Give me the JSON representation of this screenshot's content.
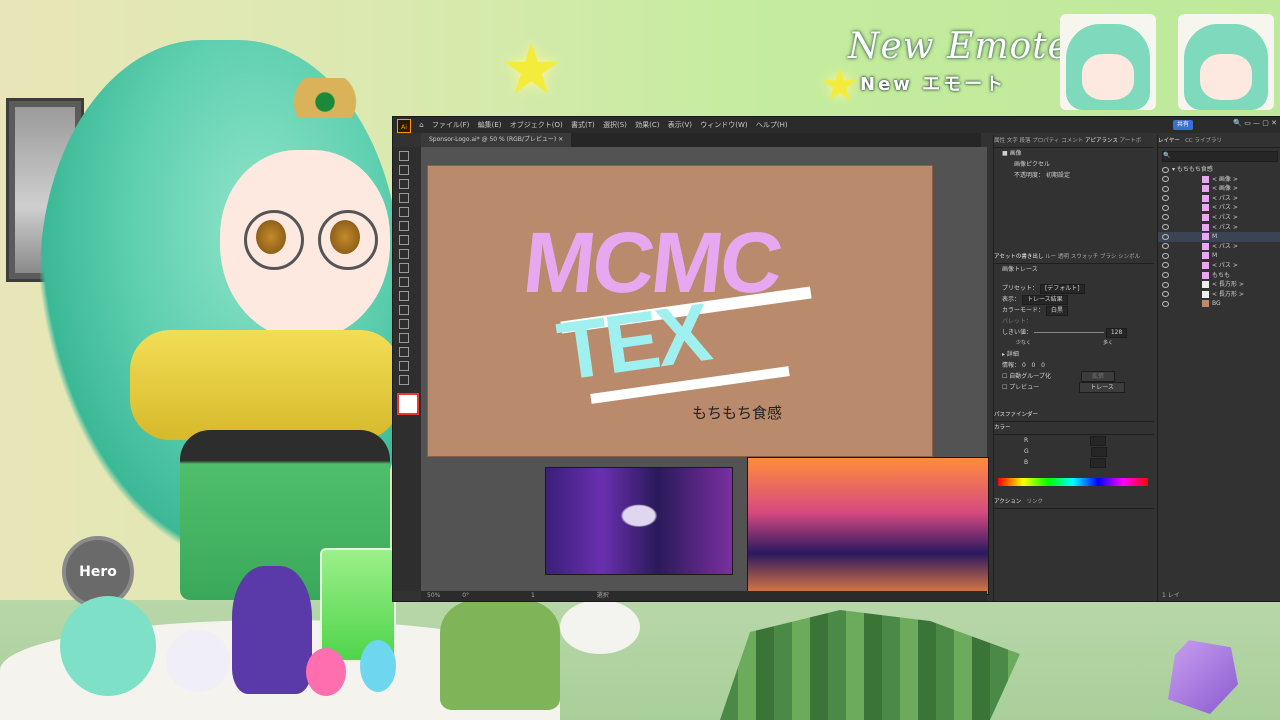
{
  "overlay": {
    "new_emotes_title": "New Emotes",
    "new_emotes_sub": "New エモート",
    "mic_label": "Hero"
  },
  "illustrator": {
    "menu": [
      "ファイル(F)",
      "編集(E)",
      "オブジェクト(O)",
      "書式(T)",
      "選択(S)",
      "効果(C)",
      "表示(V)",
      "ウィンドウ(W)",
      "ヘルプ(H)"
    ],
    "share_label": "共有",
    "doc_tab": "Sponsor-Logo.ai* @ 50 % (RGB/プレビュー)",
    "artboard": {
      "logo_line1": "MCMC",
      "logo_line2": "TEX",
      "caption": "もちもち食感"
    },
    "status": {
      "zoom": "50%",
      "rotation": "0°",
      "artboard_nav": "1",
      "mode": "選択"
    },
    "props_panel": {
      "tabs": [
        "属性",
        "文字",
        "段落",
        "プロパティ",
        "コメント",
        "アピアランス",
        "アートボ"
      ],
      "active_tab": "アピアランス",
      "object_type": "画像",
      "sub_item": "画像ピクセル",
      "opacity_label": "不透明度：",
      "opacity_value": "初期設定",
      "section2_tabs": [
        "アセットの書き出し",
        "ルー",
        "透明",
        "スウォッチ",
        "ブラシ",
        "シンボル"
      ],
      "image_trace_title": "画像トレース",
      "preset_label": "プリセット：",
      "preset_value": "[デフォルト]",
      "view_label": "表示：",
      "view_value": "トレース結果",
      "color_mode_label": "カラーモード：",
      "color_mode_value": "白黒",
      "palette_label": "パレット：",
      "threshold_label": "しきい値：",
      "threshold_value": "128",
      "threshold_low": "少なく",
      "threshold_high": "多く",
      "advanced_label": "詳細",
      "options": [
        "0",
        "0",
        "0"
      ],
      "options_label": "情報：",
      "auto_group_label": "自動グループ化",
      "expand_label": "拡張",
      "preview_label": "プレビュー",
      "trace_button": "トレース",
      "pathfinder_label": "パスファインダー",
      "color_label": "カラー",
      "color_channels": [
        "R",
        "G",
        "B"
      ],
      "actions_tabs": [
        "アクション",
        "リンク"
      ]
    },
    "layers_panel": {
      "tabs": [
        "レイヤー",
        "CC ライブラリ"
      ],
      "search_placeholder": "",
      "top_layer": "もちもち食感",
      "items": [
        "< 画像 >",
        "< 画像 >",
        "< パス >",
        "< パス >",
        "< パス >",
        "< パス >",
        "M",
        "< パス >",
        "M",
        "< パス >",
        "もちも",
        "< 長方形 >",
        "< 長方形 >",
        "BG"
      ],
      "selected_index": 6,
      "footer": "1 レイ"
    }
  },
  "colors": {
    "artboard_bg": "#b98a6b",
    "logo_pink": "#e7a8f0",
    "logo_cyan": "#9ff0ee",
    "ai_orange": "#ff9a00"
  }
}
